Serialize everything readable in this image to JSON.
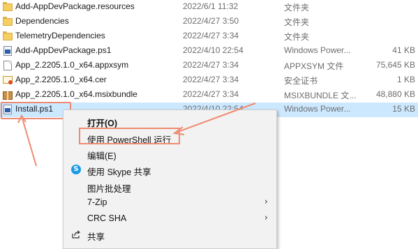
{
  "files": [
    {
      "icon": "folder-icon",
      "name": "Add-AppDevPackage.resources",
      "date": "2022/6/1 11:32",
      "type": "文件夹",
      "size": ""
    },
    {
      "icon": "folder-icon",
      "name": "Dependencies",
      "date": "2022/4/27 3:50",
      "type": "文件夹",
      "size": ""
    },
    {
      "icon": "folder-icon",
      "name": "TelemetryDependencies",
      "date": "2022/4/27 3:34",
      "type": "文件夹",
      "size": ""
    },
    {
      "icon": "powershell-script-icon",
      "name": "Add-AppDevPackage.ps1",
      "date": "2022/4/10 22:54",
      "type": "Windows Power...",
      "size": "41 KB"
    },
    {
      "icon": "document-icon",
      "name": "App_2.2205.1.0_x64.appxsym",
      "date": "2022/4/27 3:34",
      "type": "APPXSYM 文件",
      "size": "75,645 KB"
    },
    {
      "icon": "certificate-icon",
      "name": "App_2.2205.1.0_x64.cer",
      "date": "2022/4/27 3:34",
      "type": "安全证书",
      "size": "1 KB"
    },
    {
      "icon": "package-icon",
      "name": "App_2.2205.1.0_x64.msixbundle",
      "date": "2022/4/27 3:34",
      "type": "MSIXBUNDLE 文...",
      "size": "48,880 KB"
    },
    {
      "icon": "powershell-script-icon",
      "name": "Install.ps1",
      "date": "2022/4/10 22:54",
      "type": "Windows Power...",
      "size": "15 KB"
    }
  ],
  "context_menu": {
    "open": "打开(O)",
    "run_powershell": "使用 PowerShell 运行",
    "edit": "编辑(E)",
    "skype_share": "使用 Skype 共享",
    "batch_image": "图片批处理",
    "seven_zip": "7-Zip",
    "crc_sha": "CRC SHA",
    "share": "共享",
    "submenu_chevron": "›",
    "skype_glyph": "S"
  },
  "colors": {
    "selection": "#cce8ff",
    "annotation": "#f08a70",
    "menu_bg": "#f2f2f2"
  }
}
